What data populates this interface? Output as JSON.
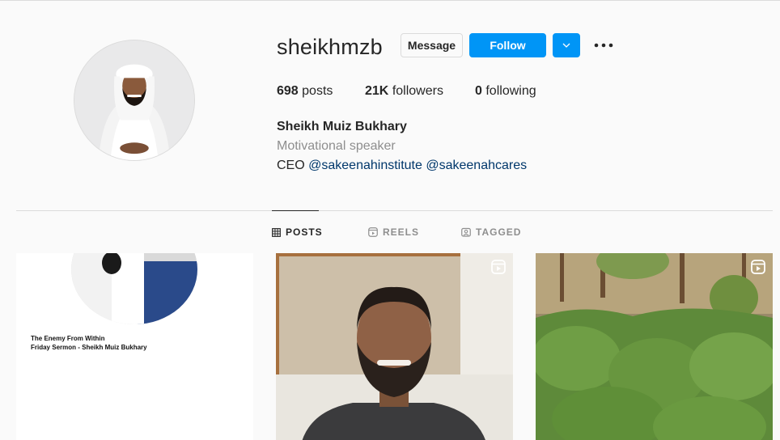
{
  "profile": {
    "username": "sheikhmzb",
    "full_name": "Sheikh Muiz Bukhary",
    "category": "Motivational speaker",
    "bio_prefix": "CEO ",
    "bio_mentions": [
      "@sakeenahinstitute",
      "@sakeenahcares"
    ]
  },
  "actions": {
    "message_label": "Message",
    "follow_label": "Follow",
    "dropdown_icon": "chevron-down-icon",
    "more_icon": "more-options-icon"
  },
  "stats": {
    "posts_count": "698",
    "posts_label": "posts",
    "followers_count": "21K",
    "followers_label": "followers",
    "following_count": "0",
    "following_label": "following"
  },
  "tabs": [
    {
      "label": "POSTS",
      "icon": "grid-icon",
      "active": true
    },
    {
      "label": "REELS",
      "icon": "reels-icon",
      "active": false
    },
    {
      "label": "TAGGED",
      "icon": "tagged-icon",
      "active": false
    }
  ],
  "posts": [
    {
      "caption_line1": "The Enemy From Within",
      "caption_line2": "Friday Sermon - Sheikh Muiz Bukhary",
      "is_reel": false
    },
    {
      "is_reel": true
    },
    {
      "is_reel": true
    }
  ],
  "colors": {
    "accent": "#0095f6",
    "mention": "#00376b",
    "muted": "#8e8e8e",
    "text": "#262626",
    "border": "#dbdbdb",
    "background": "#fafafa"
  }
}
